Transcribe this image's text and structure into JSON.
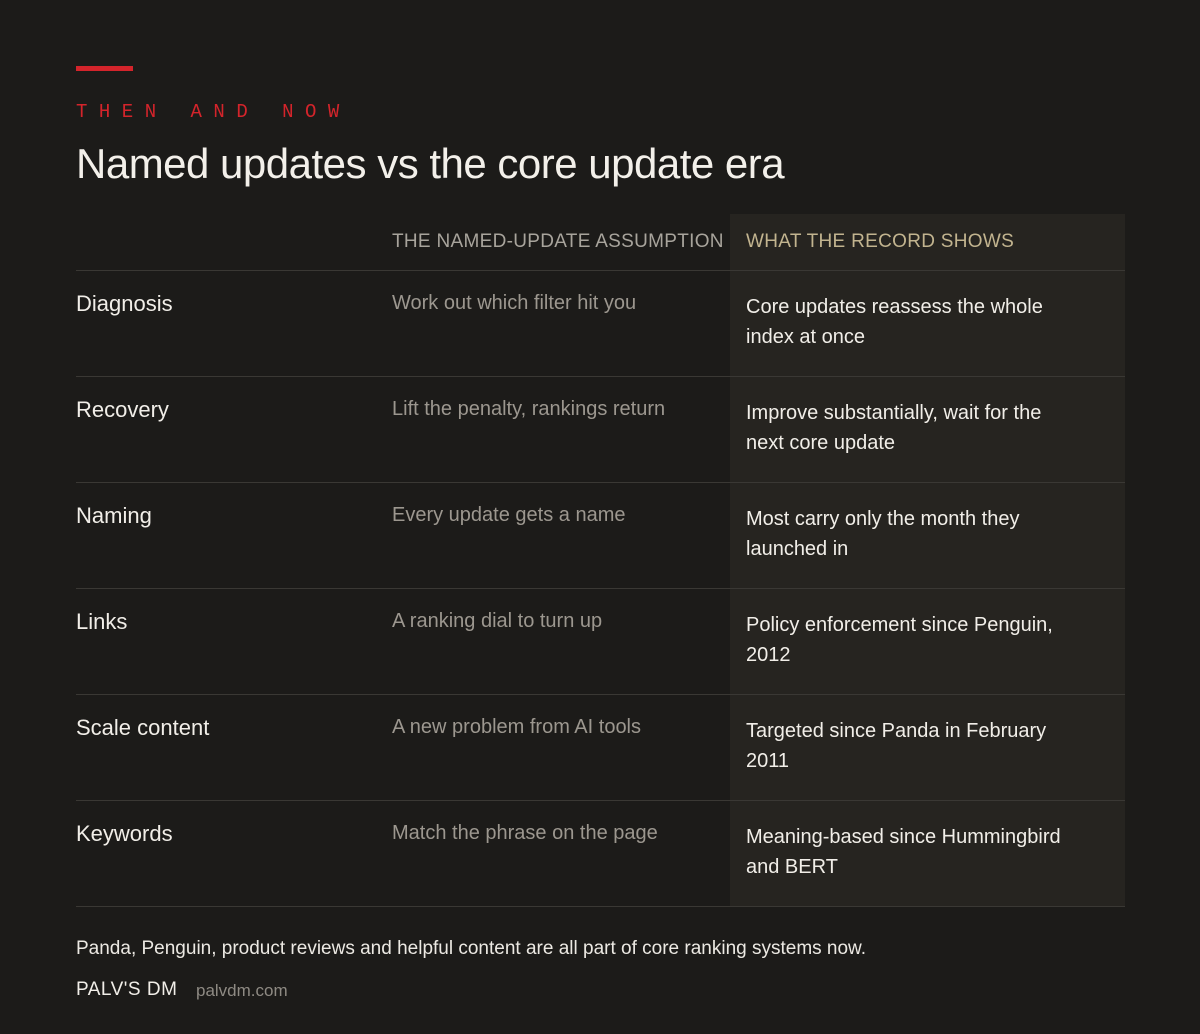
{
  "eyebrow": "THEN AND NOW",
  "title": "Named updates vs the core update era",
  "table": {
    "headers": {
      "label": "",
      "assumption": "THE NAMED-UPDATE ASSUMPTION",
      "record": "WHAT THE RECORD SHOWS"
    },
    "rows": [
      {
        "label": "Diagnosis",
        "assumption": "Work out which filter hit you",
        "record": "Core updates reassess the whole index at once"
      },
      {
        "label": "Recovery",
        "assumption": "Lift the penalty, rankings return",
        "record": "Improve substantially, wait for the next core update"
      },
      {
        "label": "Naming",
        "assumption": "Every update gets a name",
        "record": "Most carry only the month they launched in"
      },
      {
        "label": "Links",
        "assumption": "A ranking dial to turn up",
        "record": "Policy enforcement since Penguin, 2012"
      },
      {
        "label": "Scale content",
        "assumption": "A new problem from AI tools",
        "record": "Targeted since Panda in February 2011"
      },
      {
        "label": "Keywords",
        "assumption": "Match the phrase on the page",
        "record": "Meaning-based since Hummingbird and BERT"
      }
    ]
  },
  "footnote": "Panda, Penguin, product reviews and helpful content are all part of core ranking systems now.",
  "brand": {
    "name": "PALV'S DM",
    "domain": "palvdm.com"
  },
  "colors": {
    "accent": "#d4242b",
    "background": "#1c1b19",
    "highlight_column": "#262420",
    "highlight_header": "#c2b48f"
  }
}
